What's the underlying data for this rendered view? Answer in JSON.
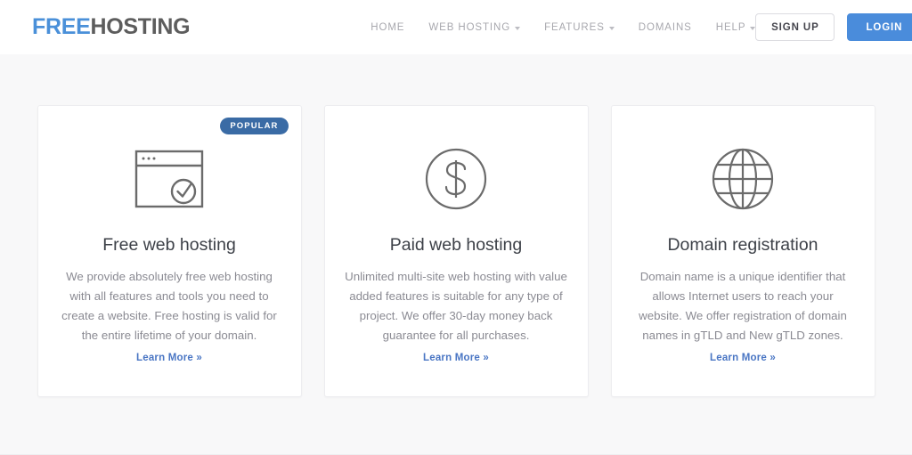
{
  "header": {
    "logo": {
      "part1": "FREE",
      "part2": "HOSTING"
    },
    "nav": [
      {
        "label": "HOME",
        "has_caret": false
      },
      {
        "label": "WEB HOSTING",
        "has_caret": true
      },
      {
        "label": "FEATURES",
        "has_caret": true
      },
      {
        "label": "DOMAINS",
        "has_caret": false
      },
      {
        "label": "HELP",
        "has_caret": true
      }
    ],
    "signup_label": "SIGN UP",
    "login_label": "LOGIN"
  },
  "colors": {
    "logo_blue": "#4a90d9",
    "logo_gray": "#5d5d5d",
    "login_blue": "#4a8cdb",
    "badge_blue": "#3a6ba5",
    "link_blue": "#4a76c4",
    "page_bg": "#f8f8f9",
    "card_bg": "#ffffff"
  },
  "cards": [
    {
      "badge": "POPULAR",
      "icon": "browser-window-check-icon",
      "title": "Free web hosting",
      "description": "We provide absolutely free web hosting with all features and tools you need to create a website. Free hosting is valid for the entire lifetime of your domain.",
      "link_label": "Learn More »"
    },
    {
      "badge": null,
      "icon": "dollar-coin-icon",
      "title": "Paid web hosting",
      "description": "Unlimited multi-site web hosting with value added features is suitable for any type of project. We offer 30-day money back guarantee for all purchases.",
      "link_label": "Learn More »"
    },
    {
      "badge": null,
      "icon": "globe-icon",
      "title": "Domain registration",
      "description": "Domain name is a unique identifier that allows Internet users to reach your website. We offer registration of domain names in gTLD and New gTLD zones.",
      "link_label": "Learn More »"
    }
  ]
}
